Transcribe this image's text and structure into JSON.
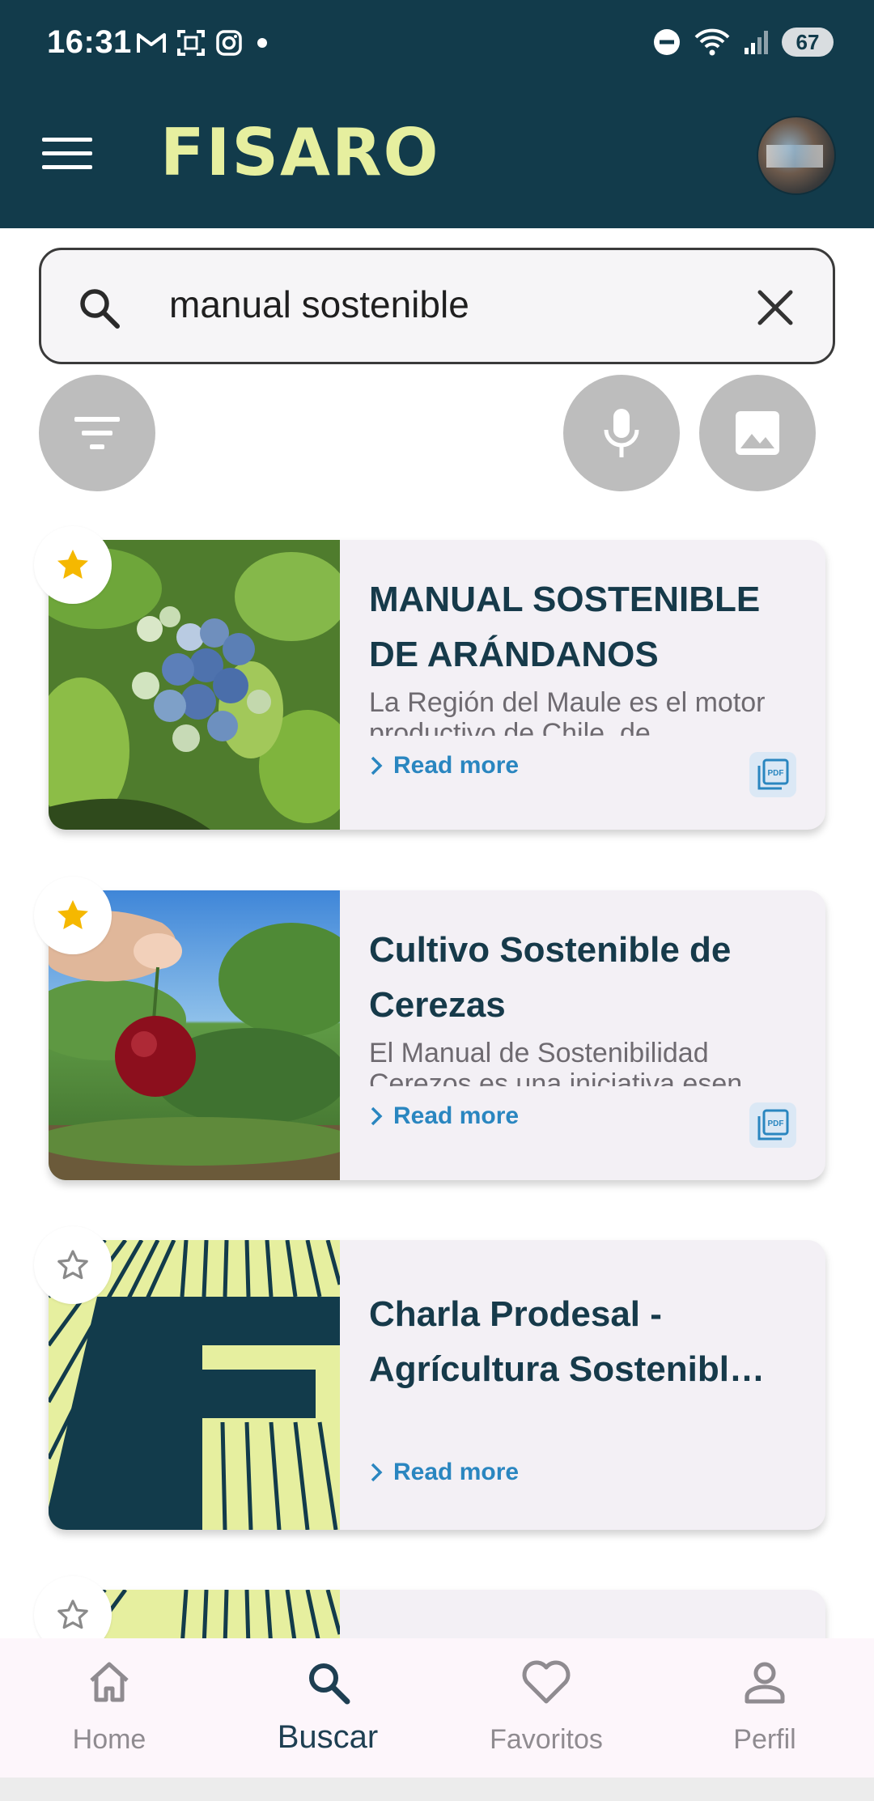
{
  "status_bar": {
    "time": "16:31",
    "battery": "67"
  },
  "header": {
    "logo": "FISARO"
  },
  "search": {
    "query": "manual sostenible",
    "placeholder": ""
  },
  "results": [
    {
      "title": "MANUAL SOSTENIBLE DE ARÁNDANOS",
      "description": "La Región del Maule es el motor productivo de Chile, de",
      "read_more": "Read more",
      "favorite": true,
      "has_pdf": true,
      "pdf_label": "PDF"
    },
    {
      "title": "Cultivo Sostenible de Cerezas",
      "description": "El Manual de Sostenibilidad Cerezos es una iniciativa esen",
      "read_more": "Read more",
      "favorite": true,
      "has_pdf": true,
      "pdf_label": "PDF"
    },
    {
      "title": "Charla Prodesal - Agrícultura Sostenibl…",
      "description": "",
      "read_more": "Read more",
      "favorite": false,
      "has_pdf": false
    }
  ],
  "bottom_nav": {
    "items": [
      {
        "label": "Home",
        "icon": "home-icon"
      },
      {
        "label": "Buscar",
        "icon": "search-icon"
      },
      {
        "label": "Favoritos",
        "icon": "heart-icon"
      },
      {
        "label": "Perfil",
        "icon": "person-icon"
      }
    ],
    "active_index": 1
  },
  "colors": {
    "header_bg": "#123b4b",
    "logo": "#e6ef9f",
    "title": "#163a4a",
    "link": "#2a86c0",
    "star": "#f5b800",
    "card_bg": "#f3f0f5"
  }
}
